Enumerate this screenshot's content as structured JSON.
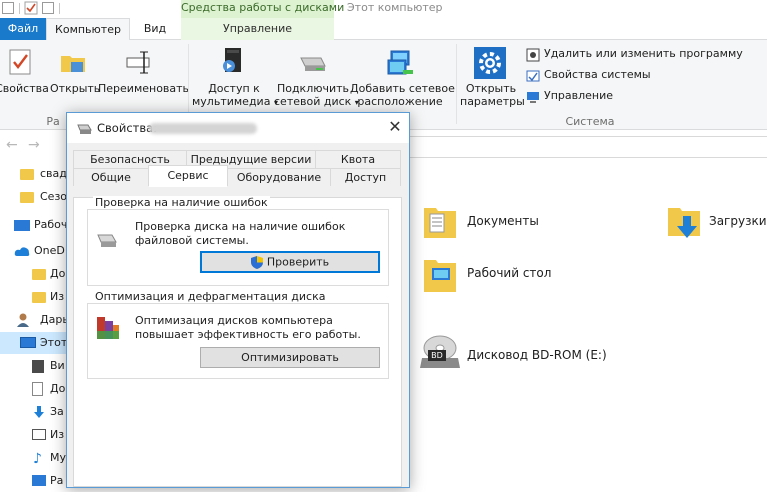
{
  "titlebar": {
    "contextual_header": "Средства работы с дисками",
    "window_title": "Этот компьютер"
  },
  "ribbon": {
    "tabs": {
      "file": "Файл",
      "computer": "Компьютер",
      "view": "Вид",
      "manage": "Управление"
    },
    "commands": {
      "properties": "Свойства",
      "open": "Открыть",
      "rename": "Переименовать",
      "media_1": "Доступ к",
      "media_2": "мультимедиа",
      "map_1": "Подключить",
      "map_2": "сетевой диск",
      "addnet_1": "Добавить сетевое",
      "addnet_2": "расположение",
      "settings_1": "Открыть",
      "settings_2": "параметры",
      "uninstall": "Удалить или изменить программу",
      "sysprops": "Свойства системы",
      "manage": "Управление"
    },
    "groups": {
      "location_partial": "Ра",
      "system": "Система"
    }
  },
  "nav_pane": {
    "items": [
      "свад",
      "Сезо",
      "Рабоч",
      "OneD",
      "До",
      "Из",
      "Дары",
      "Этот",
      "Ви",
      "До",
      "За",
      "Из",
      "Му",
      "Ра"
    ]
  },
  "content": {
    "documents": "Документы",
    "downloads": "Загрузки",
    "desktop": "Рабочий стол",
    "bd_drive": "Дисковод BD-ROM (E:)",
    "bd_badge": "BD"
  },
  "dialog": {
    "title_prefix": "Свойства:",
    "close_glyph": "✕",
    "tabs_row1": [
      "Безопасность",
      "Предыдущие версии",
      "Квота"
    ],
    "tabs_row2": [
      "Общие",
      "Сервис",
      "Оборудование",
      "Доступ"
    ],
    "check": {
      "title": "Проверка на наличие ошибок",
      "text": "Проверка диска на наличие ошибок файловой системы.",
      "button": "Проверить"
    },
    "optimize": {
      "title": "Оптимизация и дефрагментация диска",
      "text": "Оптимизация дисков компьютера повышает эффективность его работы.",
      "button": "Оптимизировать"
    }
  },
  "colors": {
    "accent": "#1979ca",
    "selection": "#cce8ff",
    "focus": "#0078d7"
  }
}
